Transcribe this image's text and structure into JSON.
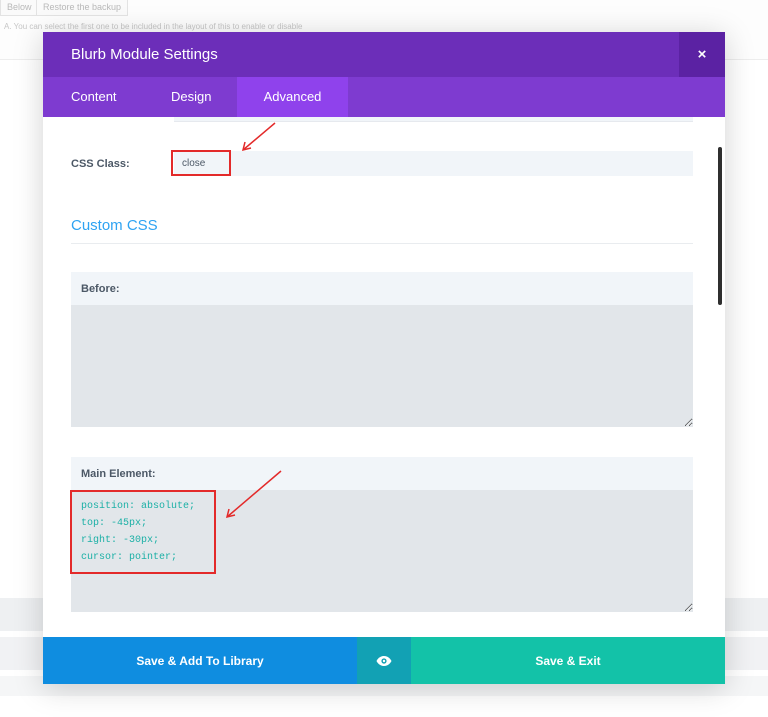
{
  "background": {
    "buttons": [
      "Below",
      "Restore the backup"
    ],
    "note": "A. You can select the first one to be included in the layout of this to enable or disable"
  },
  "modal": {
    "title": "Blurb Module Settings",
    "close_glyph": "×",
    "tabs": [
      {
        "label": "Content",
        "active": false
      },
      {
        "label": "Design",
        "active": false
      },
      {
        "label": "Advanced",
        "active": true
      }
    ]
  },
  "css_class": {
    "label": "CSS Class:",
    "value": "close"
  },
  "custom_css": {
    "title": "Custom CSS",
    "before": {
      "label": "Before:",
      "value": ""
    },
    "main_element": {
      "label": "Main Element:",
      "value": "position: absolute;\ntop: -45px;\nright: -30px;\ncursor: pointer;"
    }
  },
  "footer": {
    "save_library_label": "Save & Add To Library",
    "preview_icon": "eye-icon",
    "save_exit_label": "Save & Exit"
  },
  "colors": {
    "header": "#6c2eb9",
    "tabs": "#7e3bd0",
    "active_tab": "#8f42ec",
    "section_title": "#2ea3f2",
    "save_library": "#0f8de0",
    "preview": "#12a1b4",
    "save_exit": "#13c2a8",
    "annotation": "#e32a2a",
    "code_text": "#1cb0a6"
  }
}
